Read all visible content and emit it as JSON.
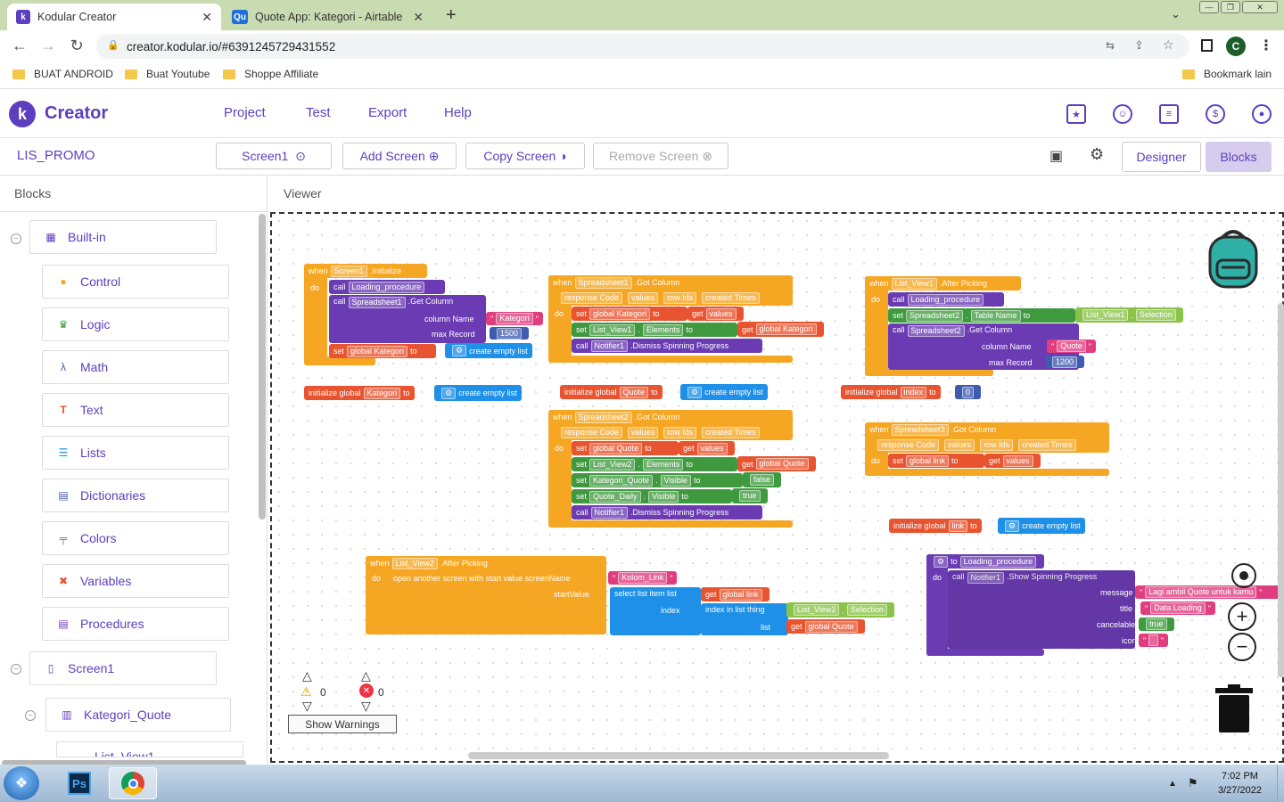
{
  "browser": {
    "tabs": [
      {
        "label": "Kodular Creator",
        "favicon": "k"
      },
      {
        "label": "Quote App: Kategori - Airtable",
        "favicon": "Qu"
      }
    ],
    "new_tab": "+",
    "url": "creator.kodular.io/#6391245729431552",
    "profile": "C",
    "bookmarks": [
      "BUAT ANDROID",
      "Buat Youtube",
      "Shoppe Affiliate"
    ],
    "other_bookmarks": "Bookmark lain"
  },
  "app": {
    "brand": "Creator",
    "menu": [
      "Project",
      "Test",
      "Export",
      "Help"
    ],
    "project_name": "LIS_PROMO",
    "screen_select": "Screen1",
    "add_screen": "Add Screen",
    "copy_screen": "Copy Screen",
    "remove_screen": "Remove Screen",
    "designer": "Designer",
    "blocks": "Blocks"
  },
  "left": {
    "title": "Blocks",
    "builtin": "Built-in",
    "items": [
      "Control",
      "Logic",
      "Math",
      "Text",
      "Lists",
      "Dictionaries",
      "Colors",
      "Variables",
      "Procedures"
    ],
    "screen": "Screen1",
    "component": "Kategori_Quote",
    "next_partial": "List_View1"
  },
  "viewer": {
    "title": "Viewer",
    "warnings_count": "0",
    "errors_count": "0",
    "show_warnings": "Show Warnings"
  },
  "blocks": {
    "when": "when",
    "do": "do",
    "call": "call",
    "set": "set",
    "to": "to",
    "get": "get",
    "b1_comp": "Screen1",
    "b1_event": ".Initialize",
    "b1_proc": "Loading_procedure",
    "b1_ss": "Spreadsheet1",
    "b1_method": ".Get Column",
    "column_name": "column Name",
    "max_record": "max Record",
    "b1_col": "Kategori",
    "b1_max": "1500",
    "b1_var": "global Kategori",
    "create_empty": "create empty list",
    "init_global": "initialize global",
    "g_kategori": "Kategori",
    "g_quote": "Quote",
    "g_index": "index",
    "g_link": "link",
    "zero": "0",
    "b2_ss": "Spreadsheet1",
    "got_column": ".Got Column",
    "resp": "response Code",
    "values": "values",
    "rowids": "row Ids",
    "created": "created Times",
    "b2_var": "global Kategori",
    "lv1": "List_View1",
    "elements": "Elements",
    "notifier": "Notifier1",
    "dismiss": ".Dismiss Spinning Progress",
    "b3_comp": "List_View1",
    "after_pick": ".After Picking",
    "b3_ss": "Spreadsheet2",
    "table_name": "Table Name",
    "selection": "Selection",
    "b3_col": "Quote",
    "b3_max": "1200",
    "b4_ss": "Spreadsheet2",
    "b4_var": "global Quote",
    "lv2": "List_View2",
    "kq": "Kategori_Quote",
    "visible": "Visible",
    "false": "false",
    "qd": "Quote_Daily",
    "true": "true",
    "b5_ss": "Spreadsheet3",
    "b5_var": "global link",
    "b6_comp": "List_View2",
    "open_screen": "open another screen with start value  screenName",
    "kolom_link": "Kolom_Link",
    "start_value": "startValue",
    "select_item": "select list item  list",
    "index": "index",
    "index_in_list": "index in list  thing",
    "list": "list",
    "proc_name": "Loading_procedure",
    "show_spin": ".Show Spinning Progress",
    "message": "message",
    "title": "title",
    "cancelable": "cancelable",
    "icon": "icon",
    "msg_val": "Lagi ambil Quote untuk kamu",
    "title_val": "Data Loading"
  },
  "taskbar": {
    "time": "7:02 PM",
    "date": "3/27/2022",
    "ps": "Ps"
  }
}
